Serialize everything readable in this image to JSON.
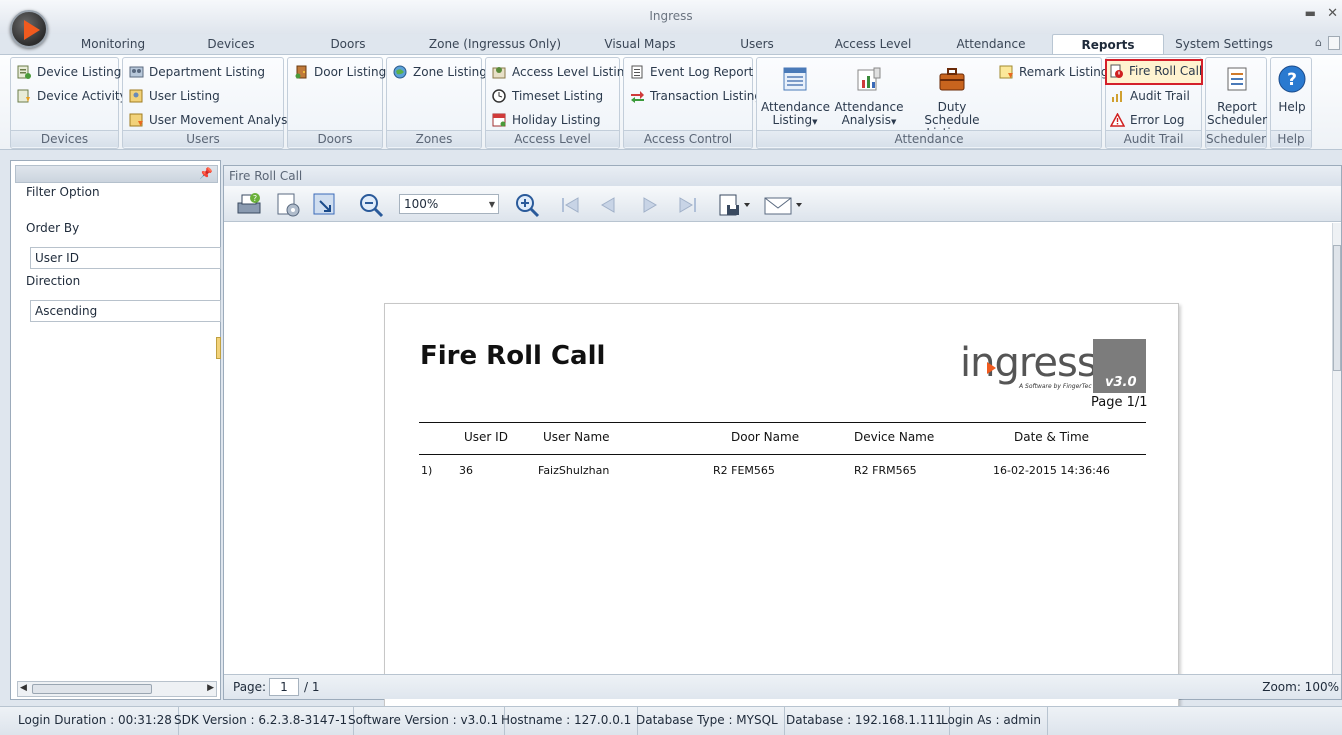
{
  "window": {
    "title": "Ingress"
  },
  "tabs": [
    "Monitoring",
    "Devices",
    "Doors",
    "Zone (Ingressus Only)",
    "Visual Maps",
    "Users",
    "Access Level",
    "Attendance",
    "Reports",
    "System Settings"
  ],
  "active_tab": "Reports",
  "ribbon": {
    "devices": {
      "label": "Devices",
      "items": [
        "Device Listing",
        "Device Activity"
      ]
    },
    "users": {
      "label": "Users",
      "items": [
        "Department Listing",
        "User Listing",
        "User Movement Analysis"
      ]
    },
    "doors": {
      "label": "Doors",
      "items": [
        "Door Listing"
      ]
    },
    "zones": {
      "label": "Zones",
      "items": [
        "Zone Listing"
      ]
    },
    "access_level": {
      "label": "Access Level",
      "items": [
        "Access Level Listing",
        "Timeset Listing",
        "Holiday Listing"
      ]
    },
    "access_control": {
      "label": "Access Control",
      "items": [
        "Event Log Report",
        "Transaction Listing"
      ]
    },
    "attendance": {
      "label": "Attendance",
      "big": [
        {
          "line1": "Attendance",
          "line2": "Listing"
        },
        {
          "line1": "Attendance",
          "line2": "Analysis"
        },
        {
          "line1": "Duty Schedule",
          "line2": "Listings"
        }
      ],
      "items": [
        "Remark Listing"
      ]
    },
    "audit_trail": {
      "label": "Audit Trail",
      "items": [
        "Fire Roll Call",
        "Audit Trail",
        "Error Log"
      ]
    },
    "scheduler": {
      "label": "Scheduler",
      "line1": "Report",
      "line2": "Scheduler"
    },
    "help": {
      "label": "Help",
      "button": "Help"
    }
  },
  "filter": {
    "title": "Filter Option",
    "order_by_label": "Order By",
    "order_by_value": "User ID",
    "direction_label": "Direction",
    "direction_value": "Ascending"
  },
  "report": {
    "panel_title": "Fire Roll Call",
    "zoom": "100%",
    "heading": "Fire Roll Call",
    "logo": {
      "word": "ingress",
      "tagline": "A Software by FingerTec",
      "version": "v3.0"
    },
    "page_label": "Page 1/1",
    "columns": [
      "User ID",
      "User Name",
      "Door Name",
      "Device Name",
      "Date & Time"
    ],
    "rows": [
      {
        "index": "1)",
        "user_id": "36",
        "user_name": "FaizShulzhan",
        "door_name": "R2 FEM565",
        "device_name": "R2 FRM565",
        "datetime": "16-02-2015 14:36:46"
      }
    ],
    "footer": {
      "page_label": "Page:",
      "page_value": "1",
      "page_total": "/ 1",
      "zoom_label": "Zoom: 100%"
    }
  },
  "status": [
    "Login Duration : 00:31:28",
    "SDK Version : 6.2.3.8-3147-1",
    "Software Version : v3.0.1",
    "Hostname : 127.0.0.1",
    "Database Type : MYSQL",
    "Database : 192.168.1.111",
    "Login As : admin"
  ],
  "colors": {
    "accent": "#f05a1e",
    "highlight": "#d4202a"
  }
}
